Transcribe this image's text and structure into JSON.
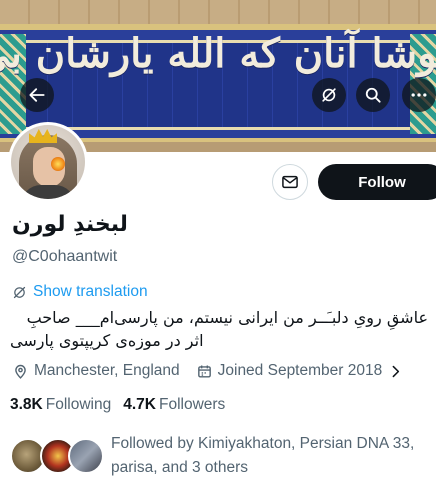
{
  "banner": {
    "calligraphy": "خوشا آنان که الله یارشان بی"
  },
  "icons": {
    "back": "arrow-left-icon",
    "grok": "grok-icon",
    "search": "search-icon",
    "more": "more-horizontal-icon",
    "message": "envelope-icon",
    "translate": "globe-slash-icon",
    "location": "location-pin-icon",
    "calendar": "calendar-icon",
    "chevron": "chevron-right-icon"
  },
  "profile": {
    "display_name": "لبخندِ لورن",
    "handle": "@C0ohaantwit",
    "follow_label": "Follow",
    "show_translation": "Show translation",
    "bio_line1": "عاشقِ رویِ دلبـَــر من ایرانی نیستم، من پارسی‌ام___ صاحبِ",
    "bio_line2": "اثر در موزه‌ی کریپتوی پارسی",
    "location": "Manchester, England",
    "joined": "Joined September 2018",
    "following_count": "3.8K",
    "following_label": "Following",
    "followers_count": "4.7K",
    "followers_label": "Followers",
    "followed_by": "Followed by Kimiyakhaton, Persian DNA 33, parisa, and 3 others"
  },
  "colors": {
    "accent": "#1d9bf0",
    "follow_bg": "#0f1419",
    "secondary_text": "#536471"
  }
}
